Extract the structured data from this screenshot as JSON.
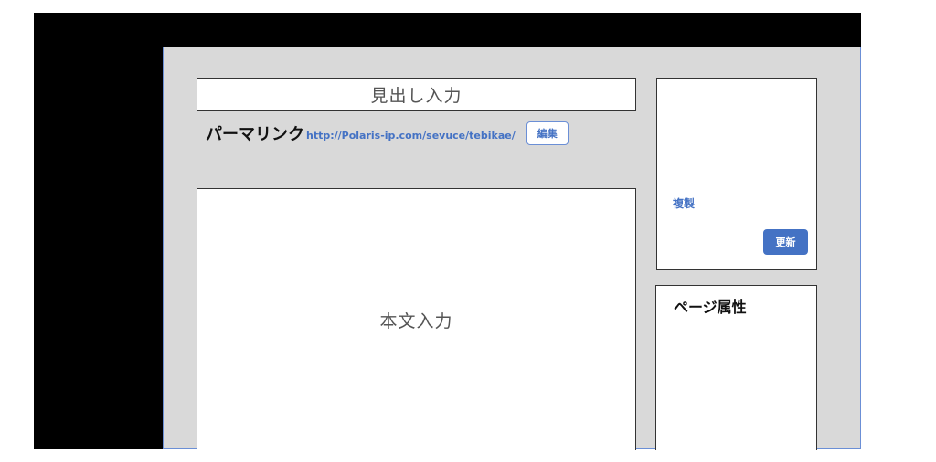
{
  "editor": {
    "title_placeholder": "見出し入力",
    "permalink_label": "パーマリンク",
    "permalink_url": "http://Polaris-ip.com/sevuce/tebikae/",
    "edit_button": "編集",
    "body_placeholder": "本文入力"
  },
  "sidebar": {
    "duplicate_link": "複製",
    "update_button": "更新",
    "page_attributes_heading": "ページ属性"
  },
  "colors": {
    "accent": "#4472c4",
    "panel_background": "#d9d9d9",
    "backdrop": "#000000"
  }
}
